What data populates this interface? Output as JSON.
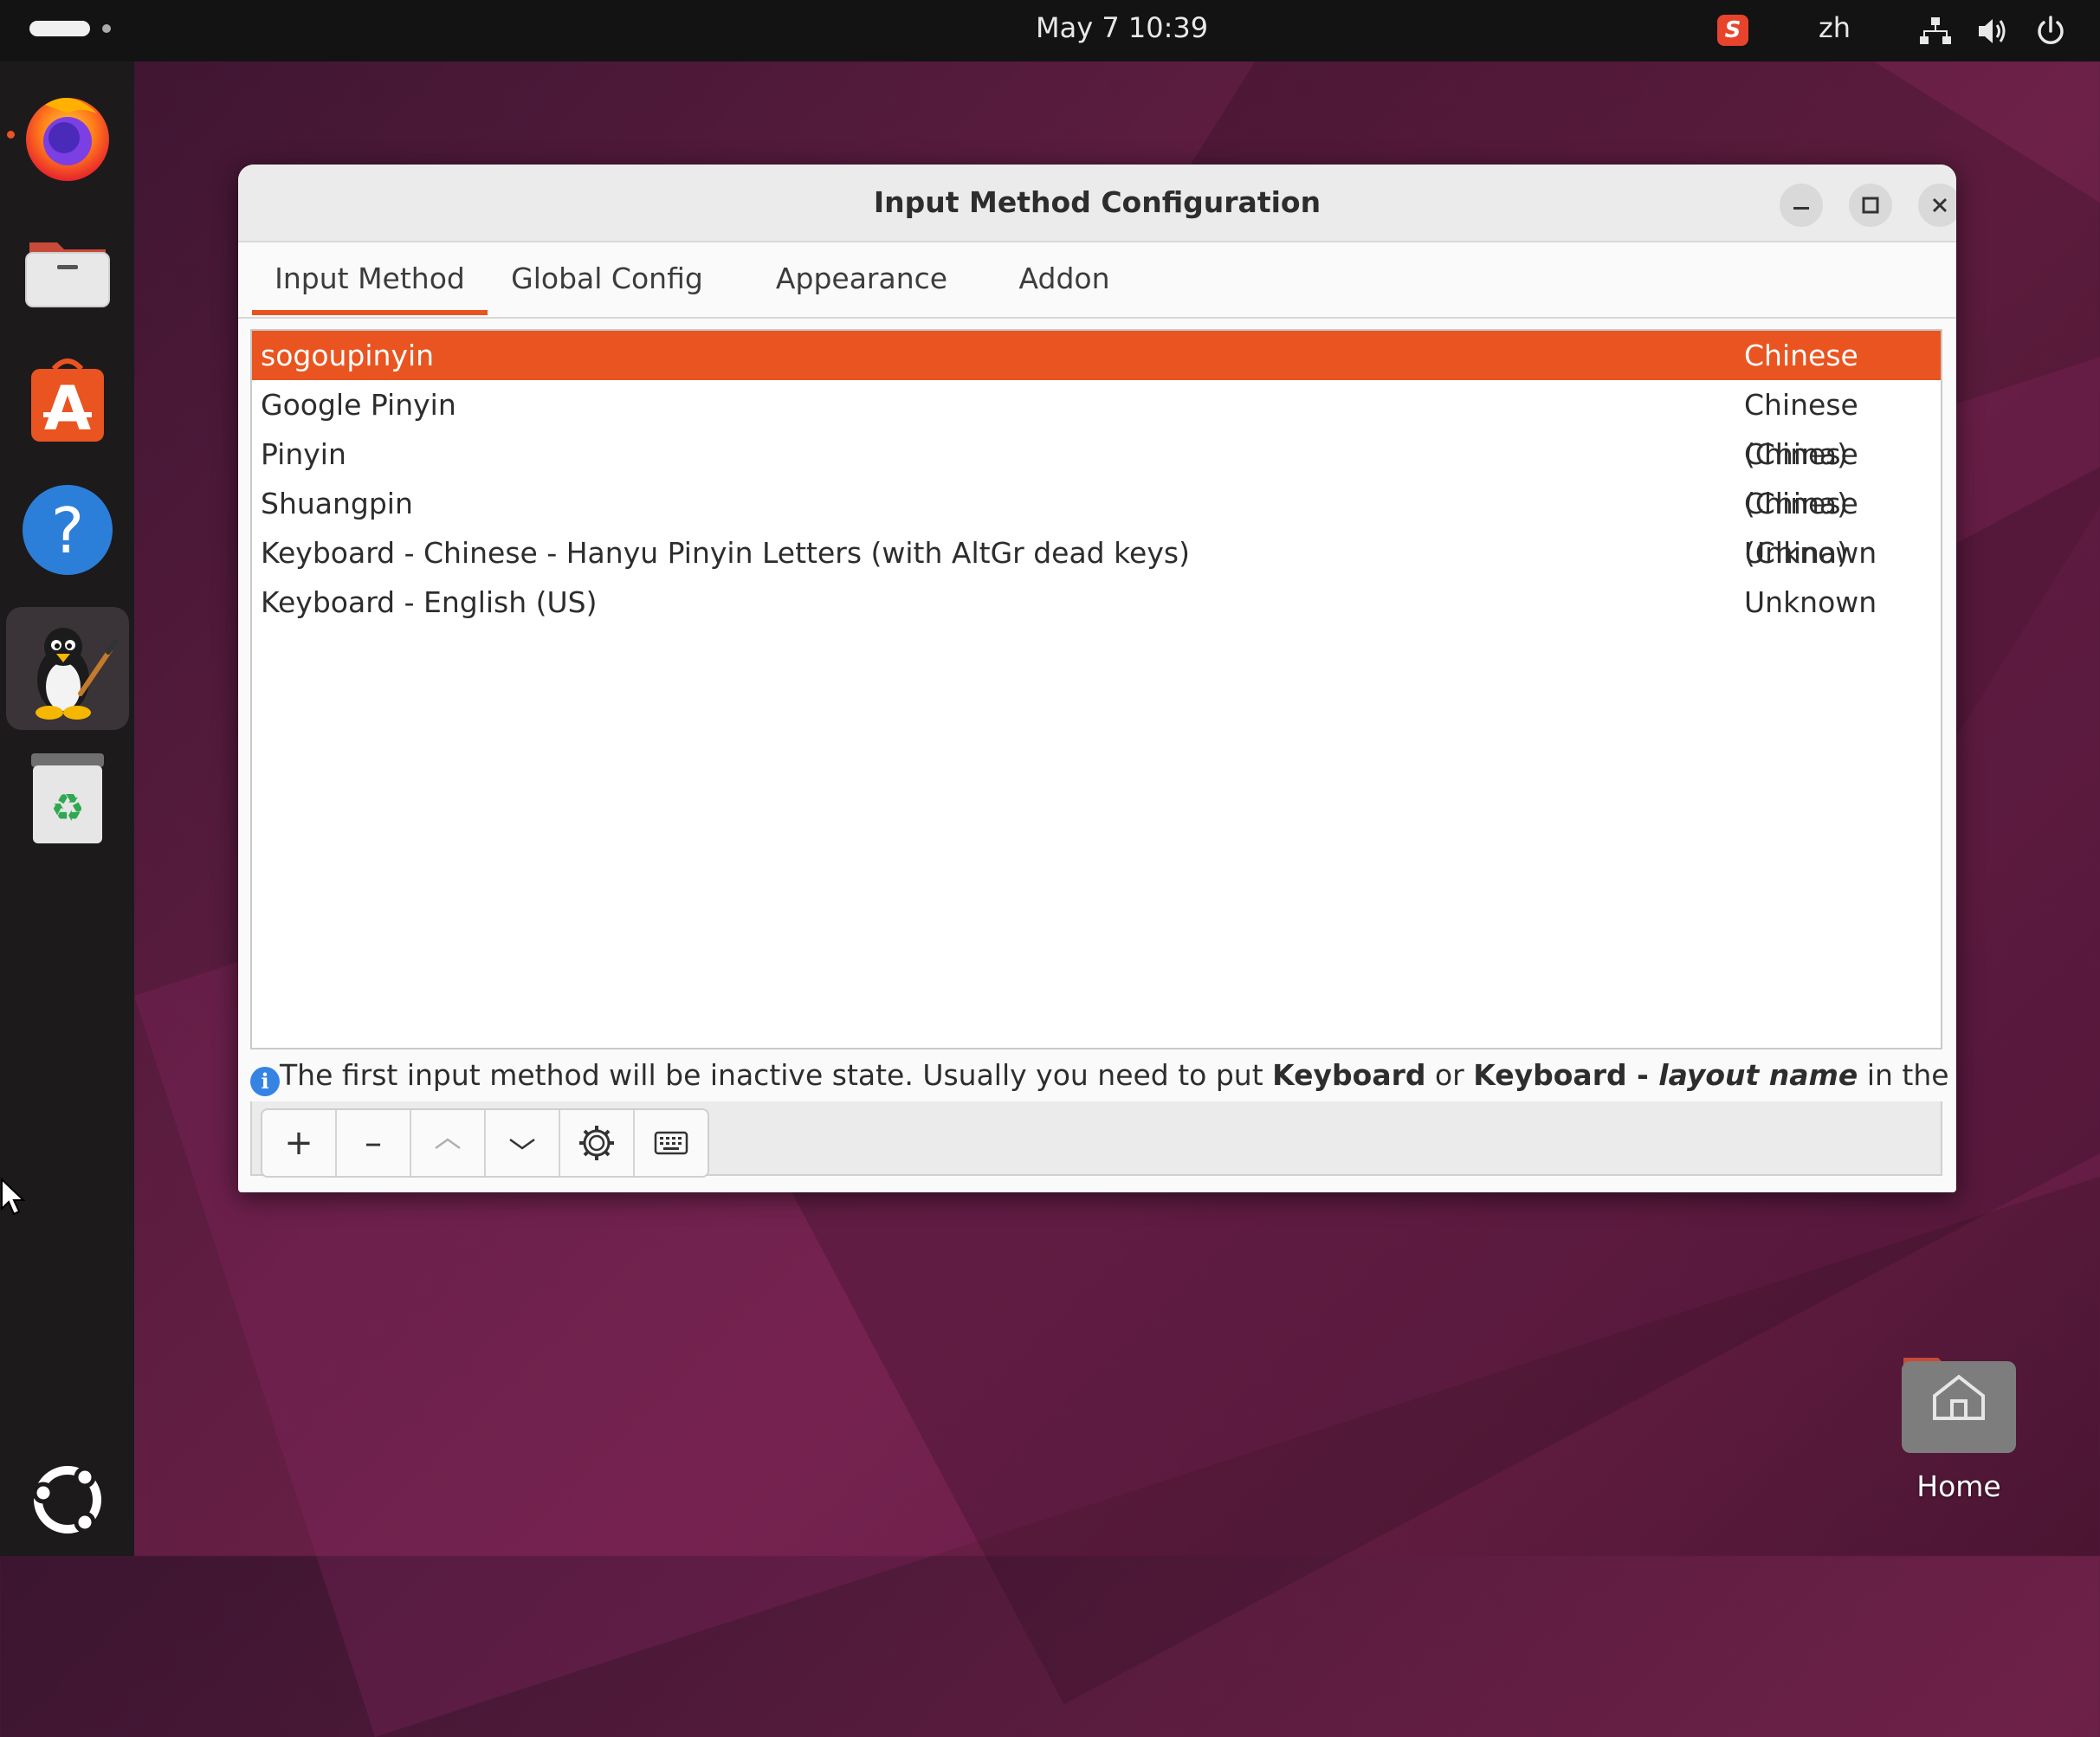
{
  "topbar": {
    "clock": "May 7  10:39",
    "tray_app": "S",
    "language": "zh",
    "icons": [
      "network-icon",
      "volume-icon",
      "power-icon"
    ]
  },
  "dock": {
    "apps": [
      "firefox-icon",
      "files-icon",
      "app-center-icon",
      "help-icon",
      "fcitx-config-icon",
      "trash-icon",
      "show-apps-icon"
    ]
  },
  "window": {
    "title": "Input Method Configuration",
    "tabs": [
      {
        "label": "Input Method"
      },
      {
        "label": "Global Config"
      },
      {
        "label": "Appearance"
      },
      {
        "label": "Addon"
      }
    ],
    "active_tab": "Input Method",
    "input_methods": [
      {
        "name": "sogoupinyin",
        "language": "Chinese (China)",
        "selected": true
      },
      {
        "name": "Google Pinyin",
        "language": "Chinese (China)"
      },
      {
        "name": "Pinyin",
        "language": "Chinese (China)"
      },
      {
        "name": "Shuangpin",
        "language": "Chinese (China)"
      },
      {
        "name": "Keyboard - Chinese - Hanyu Pinyin Letters (with AltGr dead keys)",
        "language": "Unknown"
      },
      {
        "name": "Keyboard - English (US)",
        "language": "Unknown"
      }
    ],
    "info": {
      "icon": "i",
      "text_1": "The first input method will be inactive state. Usually you need to put ",
      "bold_1": "Keyboard",
      "text_2": " or ",
      "bold_2": "Keyboard - ",
      "bold_italic": "layout name",
      "text_3": " in the first place."
    },
    "toolbar": {
      "add": "+",
      "remove": "–",
      "up": "︿",
      "down": "﹀"
    }
  },
  "desktop": {
    "home_label": "Home"
  },
  "colors": {
    "accent": "#e95420",
    "topbar": "#131313",
    "dock": "#1d1a1c"
  }
}
